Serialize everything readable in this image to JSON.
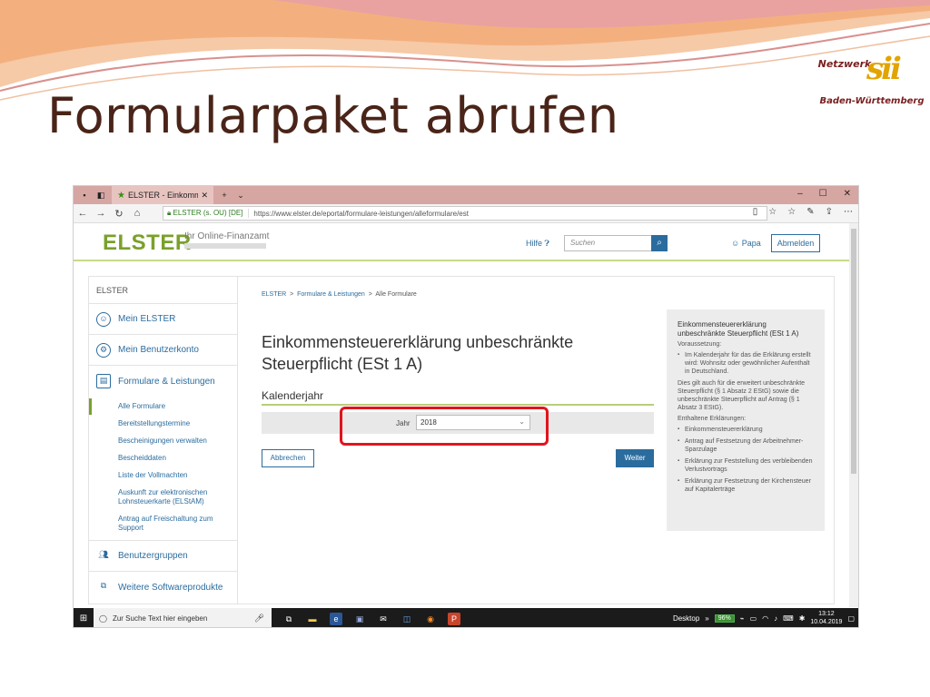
{
  "slide": {
    "title": "Formularpaket abrufen",
    "logo": {
      "line1": "Netzwerk",
      "mark": "sii",
      "line2": "Baden-Württemberg"
    }
  },
  "browser": {
    "tab_title": "ELSTER - Einkommenste",
    "window_buttons": [
      "–",
      "☐",
      "✕"
    ],
    "cert": "ELSTER (s. OU) [DE]",
    "url": "https://www.elster.de/eportal/formulare-leistungen/alleformulare/est"
  },
  "header": {
    "brand": "ELSTER",
    "brand_sub": "Ihr Online-Finanzamt",
    "help": "Hilfe",
    "search_placeholder": "Suchen",
    "user": "Papa",
    "logout": "Abmelden"
  },
  "sidebar": {
    "head": "ELSTER",
    "main_items": [
      {
        "label": "Mein ELSTER",
        "icon": "user-icon"
      },
      {
        "label": "Mein Benutzerkonto",
        "icon": "gear-icon"
      },
      {
        "label": "Formulare & Leistungen",
        "icon": "document-icon"
      },
      {
        "label": "Benutzergruppen",
        "icon": "users-icon"
      },
      {
        "label": "Weitere Softwareprodukte",
        "icon": "puzzle-icon"
      }
    ],
    "sub_items": [
      "Alle Formulare",
      "Bereitstellungstermine",
      "Bescheinigungen verwalten",
      "Bescheiddaten",
      "Liste der Vollmachten",
      "Auskunft zur elektronischen Lohnsteuerkarte (ELStAM)",
      "Antrag auf Freischaltung zum Support"
    ]
  },
  "main": {
    "breadcrumb": [
      "ELSTER",
      "Formulare & Leistungen",
      "Alle Formulare"
    ],
    "form_title": "Einkommensteuererklärung unbeschränkte Steuerpflicht (ESt 1 A)",
    "section_title": "Kalenderjahr",
    "year_label": "Jahr",
    "year_value": "2018",
    "cancel": "Abbrechen",
    "next": "Weiter"
  },
  "infobox": {
    "title": "Einkommensteuererklärung unbeschränkte Steuerpflicht (ESt 1 A)",
    "prereq_label": "Voraussetzung:",
    "prereq_items": [
      "Im Kalenderjahr für das die Erklärung erstellt wird: Wohnsitz oder gewöhnlicher Aufenthalt in Deutschland."
    ],
    "note": "Dies gilt auch für die erweitert unbeschränkte Steuerpflicht (§ 1 Absatz 2 EStG) sowie die unbeschränkte Steuerpflicht auf Antrag (§ 1 Absatz 3 EStG).",
    "contained_label": "Enthaltene Erklärungen:",
    "contained_items": [
      "Einkommensteuererklärung",
      "Antrag auf Festsetzung der Arbeitnehmer-Sparzulage",
      "Erklärung zur Feststellung des verbleibenden Verlustvortrags",
      "Erklärung zur Festsetzung der Kirchensteuer auf Kapitalerträge"
    ]
  },
  "taskbar": {
    "search_placeholder": "Zur Suche Text hier eingeben",
    "desktop": "Desktop",
    "battery": "96%",
    "time": "13:12",
    "date": "10.04.2019"
  }
}
